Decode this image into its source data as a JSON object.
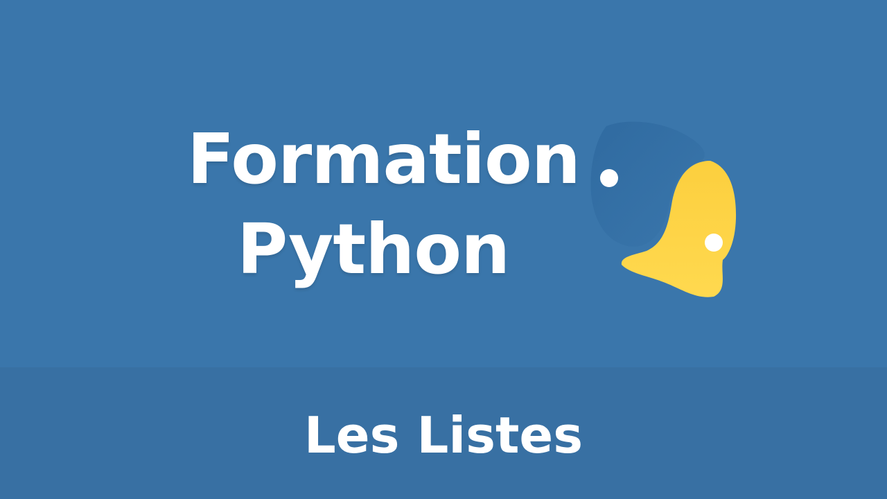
{
  "title": {
    "line1": "Formation",
    "line2": "Python"
  },
  "subtitle": "Les Listes",
  "logo": {
    "icon": "python-logo-icon",
    "colors": {
      "blue": "#336fa6",
      "blue_dark": "#2e6a9f",
      "yellow": "#fccf3e",
      "yellow_light": "#ffd94f",
      "eye": "#ffffff"
    }
  },
  "colors": {
    "background": "#3a76ab",
    "footer_band": "#3870a3",
    "text": "#ffffff"
  }
}
